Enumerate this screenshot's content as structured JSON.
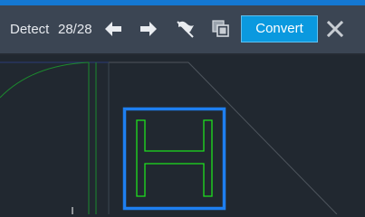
{
  "toolbar": {
    "detect_label": "Detect",
    "counter": "28/28",
    "convert_label": "Convert",
    "icons": {
      "previous": "arrow-left-icon",
      "next": "arrow-right-icon",
      "flag": "flag-icon",
      "copy": "copy-icon",
      "close": "close-icon"
    }
  },
  "colors": {
    "accent_bar": "#1478d2",
    "toolbar_bg": "#3b4553",
    "convert_bg": "#0a99df",
    "canvas_bg": "#212830",
    "selection_box": "#1e7ff0",
    "detected_shape": "#1ee01e"
  }
}
